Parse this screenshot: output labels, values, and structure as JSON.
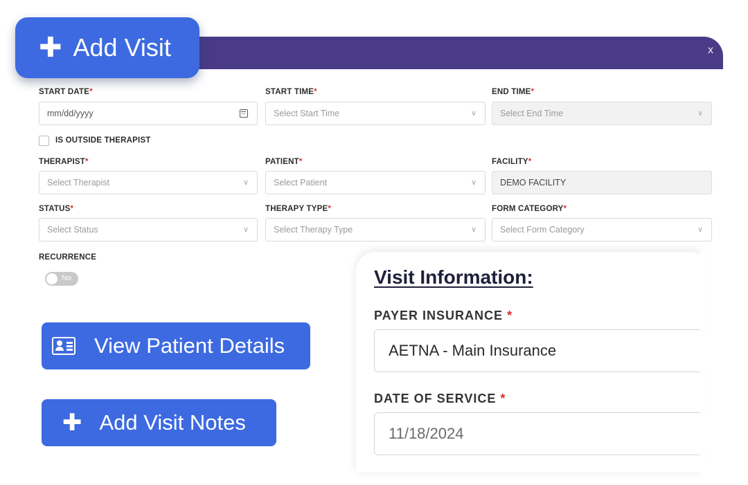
{
  "modal": {
    "close_label": "x"
  },
  "add_visit": {
    "label": "Add Visit"
  },
  "form": {
    "start_date": {
      "label": "START DATE",
      "placeholder": "mm/dd/yyyy"
    },
    "start_time": {
      "label": "START TIME",
      "placeholder": "Select Start Time"
    },
    "end_time": {
      "label": "END TIME",
      "placeholder": "Select End Time"
    },
    "outside_therapist": {
      "label": "IS OUTSIDE THERAPIST"
    },
    "therapist": {
      "label": "THERAPIST",
      "placeholder": "Select Therapist"
    },
    "patient": {
      "label": "PATIENT",
      "placeholder": "Select Patient"
    },
    "facility": {
      "label": "FACILITY",
      "value": "DEMO FACILITY"
    },
    "status": {
      "label": "STATUS",
      "placeholder": "Select Status"
    },
    "therapy_type": {
      "label": "THERAPY TYPE",
      "placeholder": "Select Therapy Type"
    },
    "form_category": {
      "label": "FORM CATEGORY",
      "placeholder": "Select Form Category"
    },
    "recurrence": {
      "label": "RECURRENCE",
      "toggle_text": "No"
    },
    "required_marker": "*"
  },
  "buttons": {
    "view_patient_details": "View Patient Details",
    "add_visit_notes": "Add Visit Notes"
  },
  "visit_info": {
    "title": "Visit Information:",
    "payer_insurance_label": "PAYER INSURANCE",
    "payer_insurance_value": "AETNA - Main Insurance",
    "date_of_service_label": "DATE OF SERVICE",
    "date_of_service_value": "11/18/2024",
    "required_marker": "*"
  },
  "colors": {
    "header_purple": "#4a3b87",
    "accent_blue": "#3d6ae0",
    "required_red": "#d63333"
  }
}
